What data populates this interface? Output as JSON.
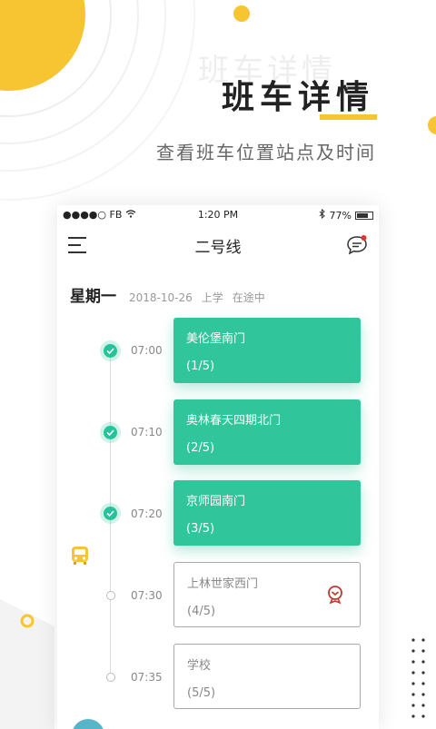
{
  "promo": {
    "ghost_text": "班车详情",
    "title": "班车详情",
    "subtitle": "查看班车位置站点及时间"
  },
  "colors": {
    "accent_yellow": "#f7c531",
    "accent_green": "#30c59a",
    "text_dark": "#222222"
  },
  "status_bar": {
    "carrier": "●●●●○ FB",
    "wifi_icon": "wifi-icon",
    "time": "1:20 PM",
    "bluetooth_icon": "bluetooth-icon",
    "battery": "77%"
  },
  "navbar": {
    "title": "二号线",
    "menu_icon": "menu-icon",
    "chat_icon": "chat-notification-icon"
  },
  "schedule": {
    "day": "星期一",
    "date": "2018-10-26",
    "period": "上学",
    "state": "在途中"
  },
  "stops": [
    {
      "time": "07:00",
      "name": "美伦堡南门",
      "index": "(1/5)",
      "status": "done"
    },
    {
      "time": "07:10",
      "name": "奥林春天四期北门",
      "index": "(2/5)",
      "status": "done"
    },
    {
      "time": "07:20",
      "name": "京师园南门",
      "index": "(3/5)",
      "status": "done"
    },
    {
      "time": "07:30",
      "name": "上林世家西门",
      "index": "(4/5)",
      "status": "todo"
    },
    {
      "time": "07:35",
      "name": "学校",
      "index": "(5/5)",
      "status": "todo"
    }
  ]
}
